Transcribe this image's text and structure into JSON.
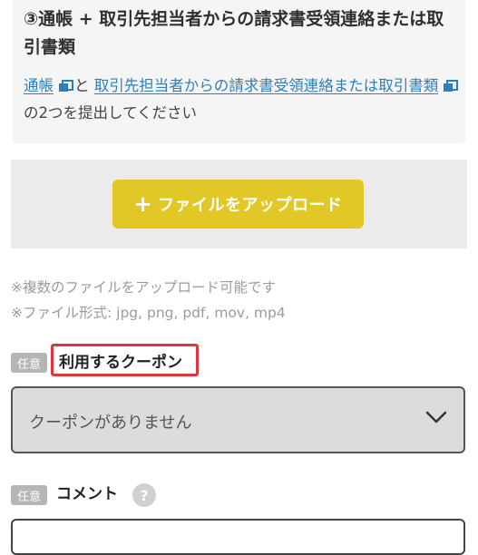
{
  "document_section": {
    "title": "③通帳 + 取引先担当者からの請求書受領連絡または取引書類",
    "link1": "通帳",
    "between": "と",
    "link2": "取引先担当者からの請求書受領連絡または取引書類",
    "tail": "の2つを提出してください"
  },
  "upload": {
    "plus": "+",
    "button_label": "ファイルをアップロード",
    "note_multiple": "※複数のファイルをアップロード可能です",
    "note_formats": "※ファイル形式: jpg, png, pdf, mov, mp4"
  },
  "coupon": {
    "badge": "任意",
    "label": "利用するクーポン",
    "selected": "クーポンがありません"
  },
  "comment": {
    "badge": "任意",
    "label": "コメント",
    "help": "?"
  },
  "colors": {
    "upload_button": "#e1c826",
    "link": "#2f7fb7",
    "highlight_border": "#e0363d"
  },
  "icons": {
    "external_link": "external-link-icon",
    "chevron": "chevron-down-icon",
    "help": "help-icon"
  }
}
